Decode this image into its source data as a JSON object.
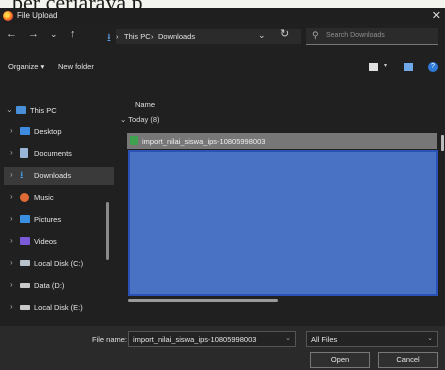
{
  "background_text": "ber cerjaraya p",
  "window": {
    "title": "File Upload",
    "close_glyph": "✕"
  },
  "nav": {
    "back": "←",
    "forward": "→",
    "recent": "⌄",
    "up": "↑",
    "download_icon": "download-arrow-icon",
    "breadcrumb": [
      "This PC",
      "Downloads"
    ],
    "sep": "›",
    "address_dropdown": "⌄",
    "refresh": "↻",
    "search_placeholder": "Search Downloads"
  },
  "toolbar": {
    "organize": "Organize ▾",
    "new_folder": "New folder",
    "help": "?"
  },
  "sidebar": {
    "items": [
      {
        "label": "This PC",
        "arrow": "⌄",
        "icon": "monitor-icon",
        "color": "#4a90d9"
      },
      {
        "label": "Desktop",
        "arrow": "›",
        "icon": "desktop-folder-icon",
        "color": "#3f8be0"
      },
      {
        "label": "Documents",
        "arrow": "›",
        "icon": "documents-icon",
        "color": "#9ab6d8"
      },
      {
        "label": "Downloads",
        "arrow": "›",
        "icon": "downloads-icon",
        "color": "#4aa0e8"
      },
      {
        "label": "Music",
        "arrow": "›",
        "icon": "music-icon",
        "color": "#e06a35"
      },
      {
        "label": "Pictures",
        "arrow": "›",
        "icon": "pictures-icon",
        "color": "#3a8fe0"
      },
      {
        "label": "Videos",
        "arrow": "›",
        "icon": "videos-icon",
        "color": "#7a5ad8"
      },
      {
        "label": "Local Disk (C:)",
        "arrow": "›",
        "icon": "disk-c-icon",
        "color": "#b9c3cc"
      },
      {
        "label": "Data (D:)",
        "arrow": "›",
        "icon": "disk-d-icon",
        "color": "#c9c9c9"
      },
      {
        "label": "Local Disk (E:)",
        "arrow": "›",
        "icon": "disk-e-icon",
        "color": "#c9c9c9"
      }
    ]
  },
  "content": {
    "column_name": "Name",
    "group_label": "Today (8)",
    "group_chevron": "⌄",
    "selected_file": "import_nilai_siswa_ips-10805998003"
  },
  "footer": {
    "file_name_label": "File name:",
    "file_name_value": "import_nilai_siswa_ips-10805998003",
    "file_type_value": "All Files",
    "dropdown_glyph": "⌄",
    "open_button": "Open",
    "cancel_button": "Cancel"
  },
  "colors": {
    "window_bg": "#202020",
    "selection": "#777777",
    "overlay_blue": "#4a72c4",
    "accent": "#2f7ad9"
  }
}
